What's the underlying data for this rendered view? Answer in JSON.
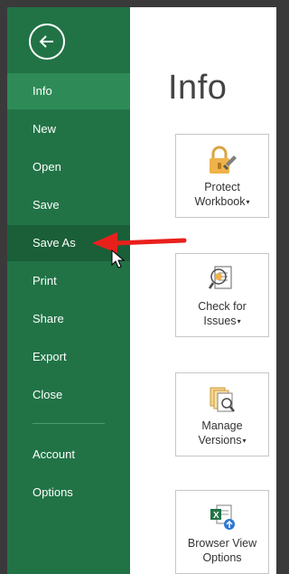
{
  "sidebar": {
    "back_icon": "back-arrow-icon",
    "items": [
      {
        "label": "Info",
        "state": "selected"
      },
      {
        "label": "New"
      },
      {
        "label": "Open"
      },
      {
        "label": "Save"
      },
      {
        "label": "Save As",
        "state": "hover"
      },
      {
        "label": "Print"
      },
      {
        "label": "Share"
      },
      {
        "label": "Export"
      },
      {
        "label": "Close"
      },
      {
        "label": "Account"
      },
      {
        "label": "Options"
      }
    ]
  },
  "main": {
    "title": "Info",
    "tiles": [
      {
        "line1": "Protect",
        "line2": "Workbook",
        "caret": "▾",
        "icon": "lock-icon"
      },
      {
        "line1": "Check for",
        "line2": "Issues",
        "caret": "▾",
        "icon": "inspect-document-icon"
      },
      {
        "line1": "Manage",
        "line2": "Versions",
        "caret": "▾",
        "icon": "versions-icon"
      },
      {
        "line1": "Browser View",
        "line2": "Options",
        "caret": "",
        "icon": "browser-view-icon"
      }
    ]
  },
  "colors": {
    "sidebar_bg": "#217346",
    "selected_bg": "#2e8b57",
    "hover_bg": "#1a5f38",
    "annotation_arrow": "#e8201c"
  }
}
